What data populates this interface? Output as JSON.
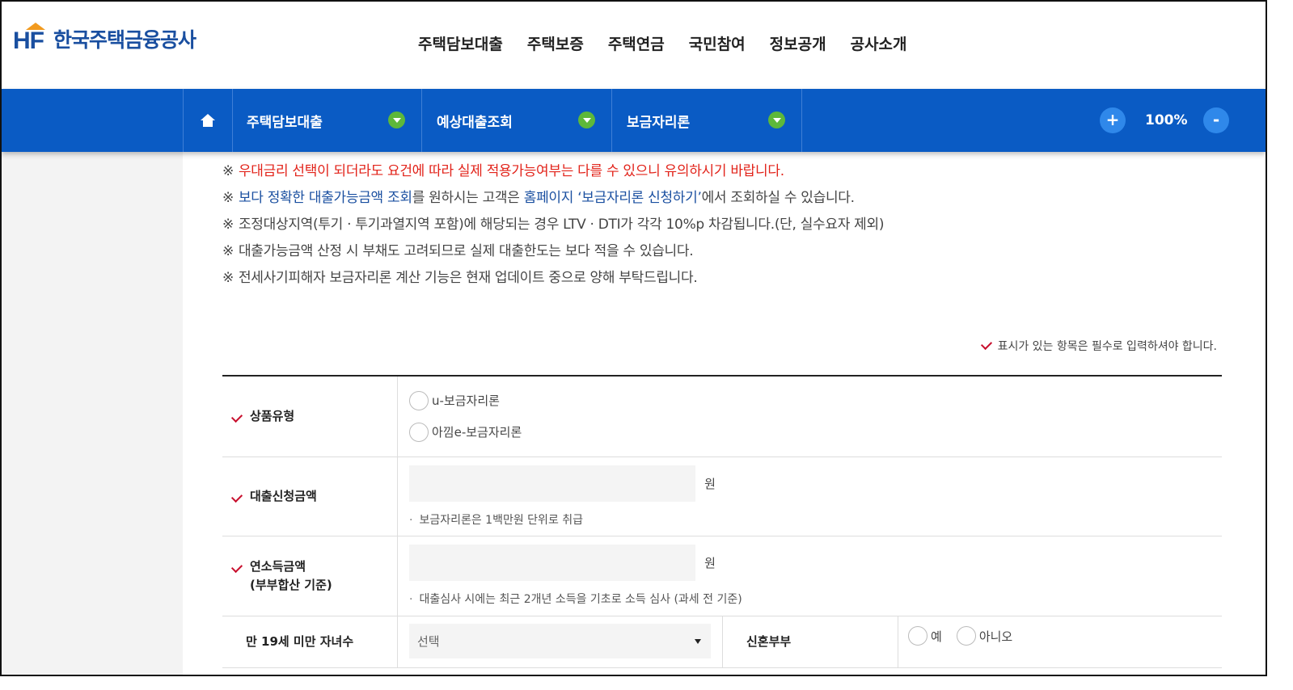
{
  "header": {
    "logo_mark": "HF",
    "logo_text": "한국주택금융공사",
    "gnb": [
      "주택담보대출",
      "주택보증",
      "주택연금",
      "국민참여",
      "정보공개",
      "공사소개"
    ]
  },
  "subnav": {
    "crumbs": [
      "주택담보대출",
      "예상대출조회",
      "보금자리론"
    ],
    "zoom_in": "+",
    "zoom_out": "-",
    "zoom_value": "100%"
  },
  "notices": {
    "mark": "※",
    "n1": "우대금리 선택이 되더라도 요건에 따라 실제 적용가능여부는 다를 수 있으니 유의하시기 바랍니다.",
    "n2_a": "보다 정확한 대출가능금액 조회",
    "n2_b": "를 원하시는 고객은 ",
    "n2_c": "홈페이지 ‘보금자리론 신청하기’",
    "n2_d": "에서 조회하실 수 있습니다.",
    "n3": "조정대상지역(투기 · 투기과열지역 포함)에 해당되는 경우 LTV · DTI가 각각 10%p 차감됩니다.(단, 실수요자 제외)",
    "n4": "대출가능금액 산정 시 부채도 고려되므로 실제 대출한도는 보다 적을 수 있습니다.",
    "n5": "전세사기피해자 보금자리론 계산 기능은 현재 업데이트 중으로 양해 부탁드립니다."
  },
  "required_note": "표시가 있는 항목은 필수로 입력하셔야 합니다.",
  "form": {
    "product": {
      "label": "상품유형",
      "options": [
        "u-보금자리론",
        "아낌e-보금자리론"
      ]
    },
    "loan_amount": {
      "label": "대출신청금액",
      "value": "",
      "unit": "원",
      "hint": "보금자리론은 1백만원 단위로 취급"
    },
    "income": {
      "label_1": "연소득금액",
      "label_2": "(부부합산 기준)",
      "value": "",
      "unit": "원",
      "hint": "대출심사 시에는 최근 2개년 소득을 기초로 소득 심사 (과세 전 기준)"
    },
    "children": {
      "label": "만 19세 미만 자녀수",
      "selected": "선택"
    },
    "newlywed": {
      "label": "신혼부부",
      "options": [
        "예",
        "아니오"
      ]
    }
  }
}
